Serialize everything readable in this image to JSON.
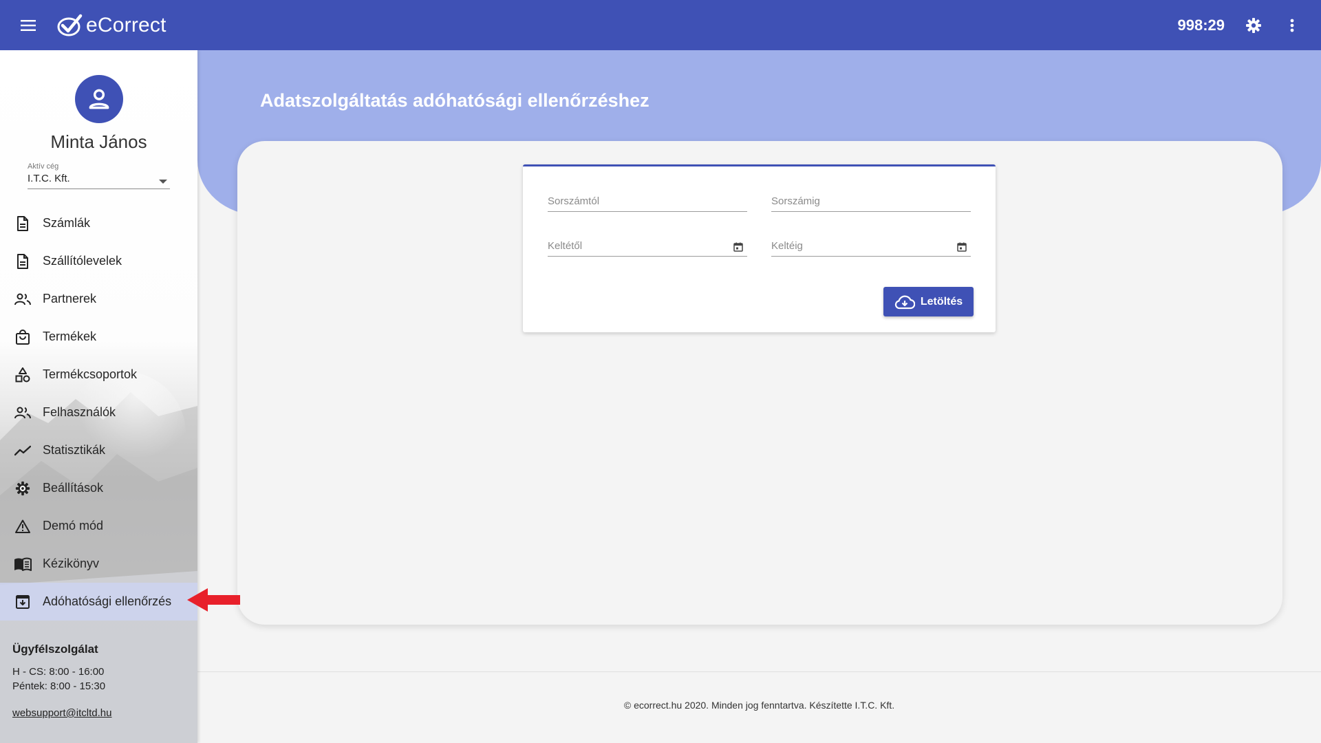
{
  "header": {
    "app_name": "eCorrect",
    "timer": "998:29",
    "icons": {
      "menu": "menu-icon",
      "settings": "gear-icon",
      "more": "more-vertical-icon"
    },
    "background_color": "#3f51b5"
  },
  "sidebar": {
    "user_name": "Minta János",
    "company_label": "Aktív cég",
    "company_value": "I.T.C. Kft.",
    "items": [
      {
        "label": "Számlák",
        "icon": "document-icon"
      },
      {
        "label": "Szállítólevelek",
        "icon": "document-icon"
      },
      {
        "label": "Partnerek",
        "icon": "people-icon"
      },
      {
        "label": "Termékek",
        "icon": "shopping-bag-icon"
      },
      {
        "label": "Termékcsoportok",
        "icon": "category-icon"
      },
      {
        "label": "Felhasználók",
        "icon": "people-icon"
      },
      {
        "label": "Statisztikák",
        "icon": "trending-line-icon"
      },
      {
        "label": "Beállítások",
        "icon": "gear-icon"
      },
      {
        "label": "Demó mód",
        "icon": "warning-triangle-icon"
      },
      {
        "label": "Kézikönyv",
        "icon": "book-icon"
      },
      {
        "label": "Adóhatósági ellenőrzés",
        "icon": "archive-download-icon",
        "active": true
      }
    ],
    "support": {
      "title": "Ügyfélszolgálat",
      "hours_1": "H - CS: 8:00 - 16:00",
      "hours_2": "Péntek: 8:00 - 15:30",
      "email": "websupport@itcltd.hu"
    }
  },
  "main": {
    "title": "Adatszolgáltatás adóhatósági ellenőrzéshez",
    "form": {
      "from_number_label": "Sorszámtól",
      "to_number_label": "Sorszámig",
      "from_date_label": "Keltétől",
      "to_date_label": "Keltéig",
      "download_label": "Letöltés"
    },
    "accent_color": "#9fafea"
  },
  "annotation": {
    "arrow_color": "#e8202a"
  },
  "footer": {
    "text": "© ecorrect.hu 2020. Minden jog fenntartva. Készítette I.T.C. Kft."
  }
}
